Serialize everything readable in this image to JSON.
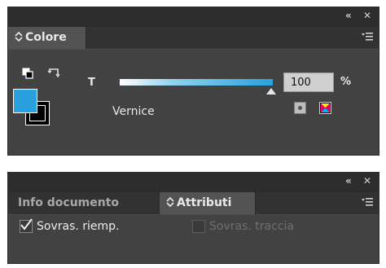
{
  "colors": {
    "fill": "#2aa0dc",
    "stroke": "#000000",
    "panel_bg": "#424242",
    "titlebar_bg": "#2d2d2d"
  },
  "color_panel": {
    "controls": {
      "collapse": "«",
      "close": "✕"
    },
    "tab": {
      "label": "Colore"
    },
    "tint_label": "T",
    "tint_value": "100",
    "tint_percent": 100,
    "percent_sign": "%",
    "paint_label": "Vernice",
    "icons": {
      "menu": "panel-menu-icon",
      "default_colors": "default-fill-stroke-icon",
      "swap": "swap-fill-stroke-icon",
      "none": "none-swatch-icon",
      "registration": "registration-swatch-icon"
    }
  },
  "attributes_panel": {
    "controls": {
      "collapse": "«",
      "close": "✕"
    },
    "tabs": [
      {
        "label": "Info documento",
        "active": false
      },
      {
        "label": "Attributi",
        "active": true
      }
    ],
    "overprint_fill": {
      "label": "Sovras. riemp.",
      "checked": true,
      "enabled": true
    },
    "overprint_stroke": {
      "label": "Sovras. traccia",
      "checked": false,
      "enabled": false
    }
  }
}
